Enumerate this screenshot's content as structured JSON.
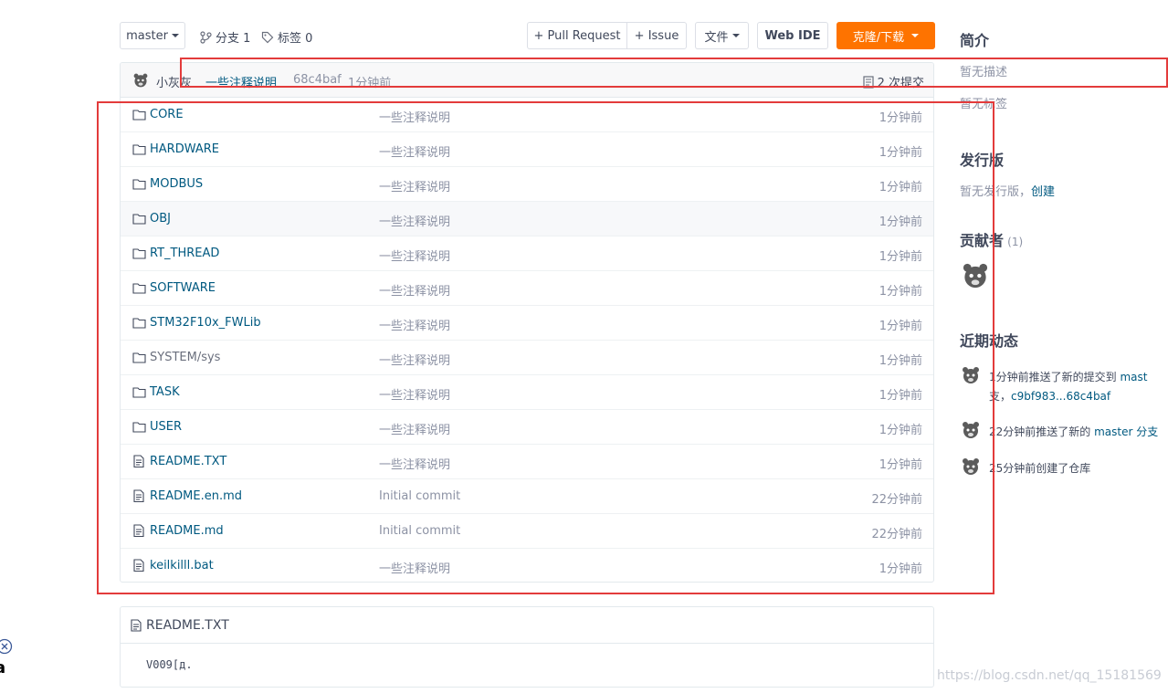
{
  "toolbar": {
    "branch": "master",
    "branches_label": "分支 1",
    "tags_label": "标签 0",
    "pull_request": "+ Pull Request",
    "issue": "+ Issue",
    "files": "文件",
    "web_ide": "Web IDE",
    "clone": "克隆/下载"
  },
  "commit": {
    "author": "小灰灰",
    "message": "一些注释说明",
    "hash": "68c4baf",
    "time": "1分钟前",
    "count": "2 次提交"
  },
  "files": [
    {
      "name": "CORE",
      "type": "folder",
      "message": "一些注释说明",
      "time": "1分钟前"
    },
    {
      "name": "HARDWARE",
      "type": "folder",
      "message": "一些注释说明",
      "time": "1分钟前"
    },
    {
      "name": "MODBUS",
      "type": "folder",
      "message": "一些注释说明",
      "time": "1分钟前"
    },
    {
      "name": "OBJ",
      "type": "folder",
      "message": "一些注释说明",
      "time": "1分钟前"
    },
    {
      "name": "RT_THREAD",
      "type": "folder",
      "message": "一些注释说明",
      "time": "1分钟前"
    },
    {
      "name": "SOFTWARE",
      "type": "folder",
      "message": "一些注释说明",
      "time": "1分钟前"
    },
    {
      "name": "STM32F10x_FWLib",
      "type": "folder",
      "message": "一些注释说明",
      "time": "1分钟前"
    },
    {
      "name": "SYSTEM/sys",
      "type": "folder",
      "message": "一些注释说明",
      "time": "1分钟前"
    },
    {
      "name": "TASK",
      "type": "folder",
      "message": "一些注释说明",
      "time": "1分钟前"
    },
    {
      "name": "USER",
      "type": "folder",
      "message": "一些注释说明",
      "time": "1分钟前"
    },
    {
      "name": "README.TXT",
      "type": "file",
      "message": "一些注释说明",
      "time": "1分钟前"
    },
    {
      "name": "README.en.md",
      "type": "file",
      "message": "Initial commit",
      "time": "22分钟前"
    },
    {
      "name": "README.md",
      "type": "file",
      "message": "Initial commit",
      "time": "22分钟前"
    },
    {
      "name": "keilkilll.bat",
      "type": "file",
      "message": "一些注释说明",
      "time": "1分钟前"
    }
  ],
  "readme": {
    "title": "README.TXT",
    "content": "V009[д."
  },
  "sidebar": {
    "intro_heading": "简介",
    "no_description": "暂无描述",
    "no_tags": "暂无标签",
    "release_heading": "发行版",
    "no_release": "暂无发行版，",
    "create_link": "创建",
    "contributors_heading": "贡献者",
    "contributors_count": "(1)",
    "activity_heading": "近期动态",
    "activity": [
      {
        "text": "1分钟前推送了新的提交到 ",
        "link": "mast",
        "line2_prefix": "支，",
        "line2_link": "c9bf983...68c4baf"
      },
      {
        "text": "22分钟前推送了新的 ",
        "link": "master 分支"
      },
      {
        "text": "25分钟前创建了仓库"
      }
    ]
  },
  "left_edge_fragment": "a",
  "watermark": "https://blog.csdn.net/qq_15181569",
  "colors": {
    "link": "#005980",
    "muted": "#8c92a4",
    "clone_button": "#fe7300",
    "highlight_box": "#e33b3b"
  }
}
